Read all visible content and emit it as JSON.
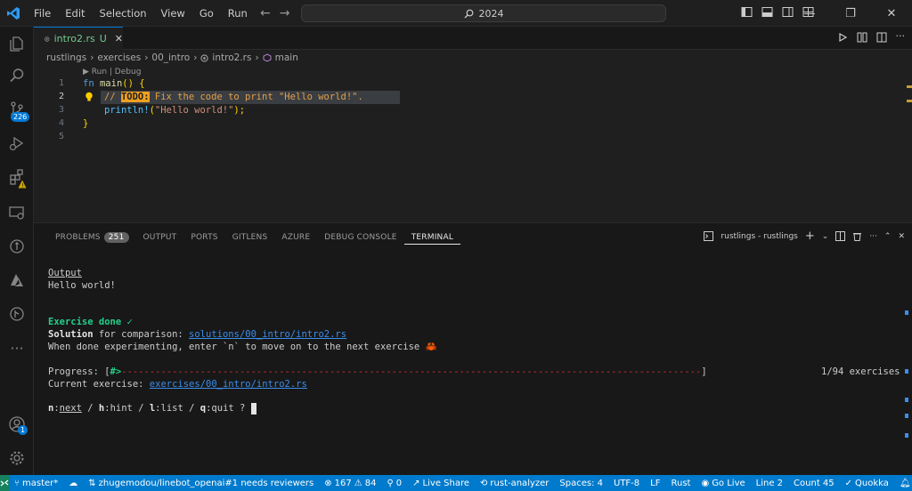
{
  "titlebar": {
    "menu": [
      "File",
      "Edit",
      "Selection",
      "View",
      "Go",
      "Run"
    ],
    "search_text": "2024"
  },
  "activity_badges": {
    "source_control": "226",
    "accounts": "1"
  },
  "tab": {
    "filename": "intro2.rs",
    "modified": "U"
  },
  "breadcrumb": [
    "rustlings",
    "exercises",
    "00_intro",
    "intro2.rs",
    "main"
  ],
  "editor": {
    "codelens": "Run | Debug",
    "line_numbers": [
      "1",
      "2",
      "3",
      "4",
      "5"
    ],
    "line1": {
      "kw": "fn",
      "name": "main",
      "rest": "() {"
    },
    "line2": {
      "prefix": "// ",
      "todo": "TODO:",
      "comment": " Fix the code to print \"Hello world!\"."
    },
    "line3": {
      "macro": "println!",
      "open": "(",
      "str": "\"Hello world!\"",
      "close": ");"
    },
    "line4": "}"
  },
  "panel": {
    "tabs": [
      "PROBLEMS",
      "OUTPUT",
      "PORTS",
      "GITLENS",
      "AZURE",
      "DEBUG CONSOLE",
      "TERMINAL"
    ],
    "problems_count": "251",
    "terminal_name": "rustlings - rustlings"
  },
  "terminal": {
    "output_header": "Output",
    "output_text": "Hello world!",
    "done": "Exercise done ✓",
    "solution_label": "Solution",
    "solution_mid": " for comparison: ",
    "solution_path": "solutions/00_intro/intro2.rs",
    "experiment": "When done experimenting, enter `n` to move on to the next exercise 🦀",
    "progress_label": "Progress: [",
    "progress_bar": "#>",
    "progress_dashes": "-------------------------------------------------------------------------------------------------------",
    "progress_close": "]",
    "progress_count": "1/94 exercises",
    "current_label": "Current exercise: ",
    "current_path": "exercises/00_intro/intro2.rs",
    "commands": [
      {
        "key": "n",
        "sep": ":",
        "word": "next"
      },
      {
        "key": "h",
        "sep": ":",
        "word": "hint"
      },
      {
        "key": "l",
        "sep": ":",
        "word": "list"
      },
      {
        "key": "q",
        "sep": ":",
        "word": "quit ?"
      }
    ]
  },
  "statusbar": {
    "branch": "master*",
    "pr": "zhugemodou/linebot_openai#1 needs reviewers",
    "errors": "167",
    "warnings": "84",
    "ports": "0",
    "liveshare": "Live Share",
    "analyzer": "rust-analyzer",
    "spaces": "Spaces: 4",
    "encoding": "UTF-8",
    "eol": "LF",
    "language": "Rust",
    "golive": "Go Live",
    "line": "Line 2",
    "count": "Count 45",
    "quokka": "Quokka"
  },
  "colors": {
    "accent": "#007acc",
    "remote": "#16825d",
    "todo": "#f0a020",
    "success": "#23d18b"
  }
}
